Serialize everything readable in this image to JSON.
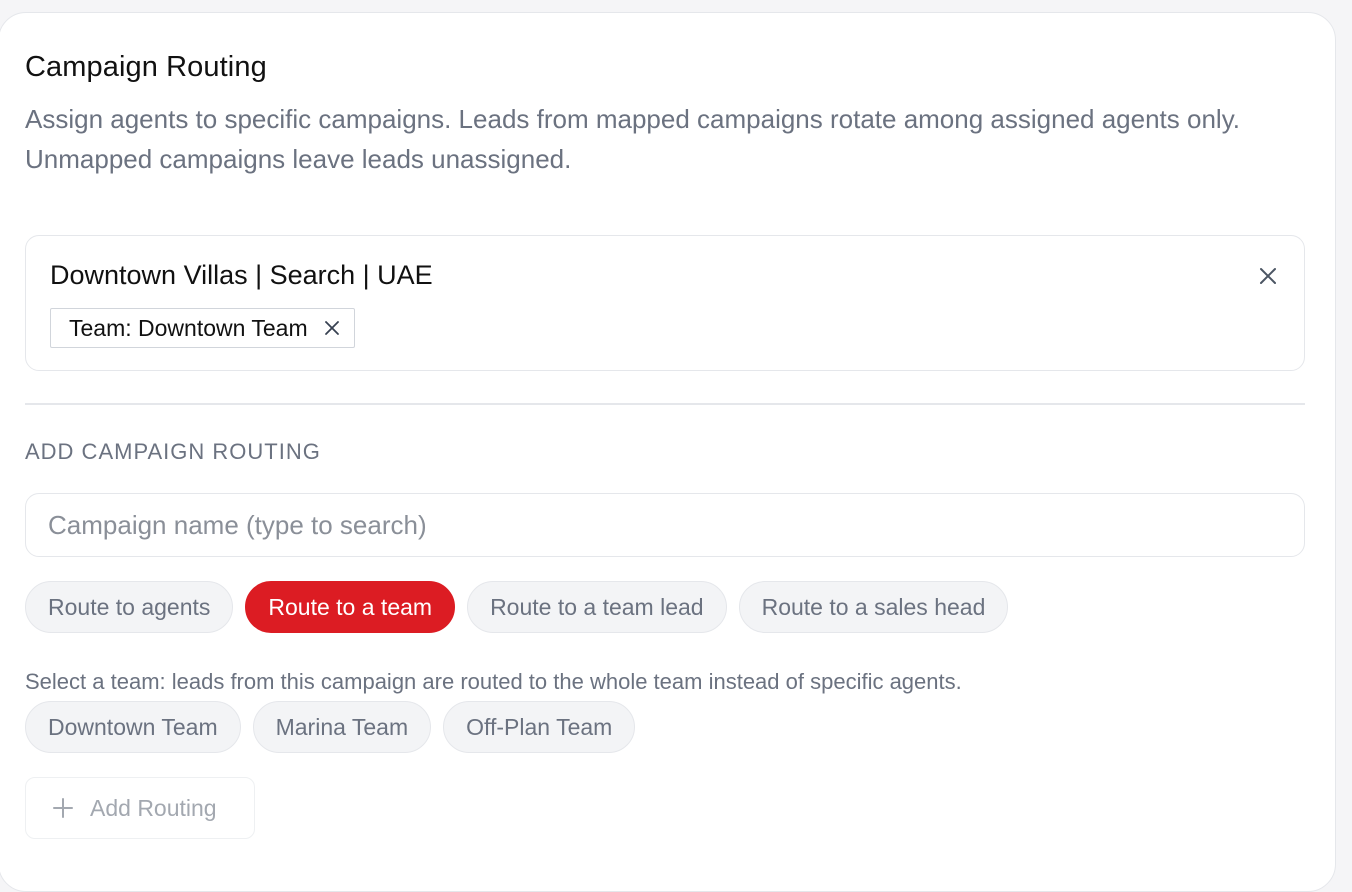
{
  "section": {
    "title": "Campaign Routing",
    "description": "Assign agents to specific campaigns. Leads from mapped campaigns rotate among assigned agents only. Unmapped campaigns leave leads unassigned."
  },
  "mapping": {
    "campaign_name": "Downtown Villas | Search | UAE",
    "tag_label": "Team: Downtown Team",
    "close_icon": "close-icon",
    "tag_remove_icon": "close-icon"
  },
  "add_routing": {
    "section_label": "ADD CAMPAIGN ROUTING",
    "search_placeholder": "Campaign name (type to search)",
    "search_value": "",
    "route_options": [
      {
        "label": "Route to agents",
        "selected": false
      },
      {
        "label": "Route to a team",
        "selected": true
      },
      {
        "label": "Route to a team lead",
        "selected": false
      },
      {
        "label": "Route to a sales head",
        "selected": false
      }
    ],
    "hint": "Select a team: leads from this campaign are routed to the whole team instead of specific agents.",
    "teams": [
      {
        "label": "Downtown Team"
      },
      {
        "label": "Marina Team"
      },
      {
        "label": "Off-Plan Team"
      }
    ],
    "add_button_label": "Add Routing",
    "add_button_icon": "plus-icon"
  },
  "colors": {
    "accent": "#dc1c23",
    "muted_text": "#6b7280",
    "border": "#e5e7eb"
  }
}
